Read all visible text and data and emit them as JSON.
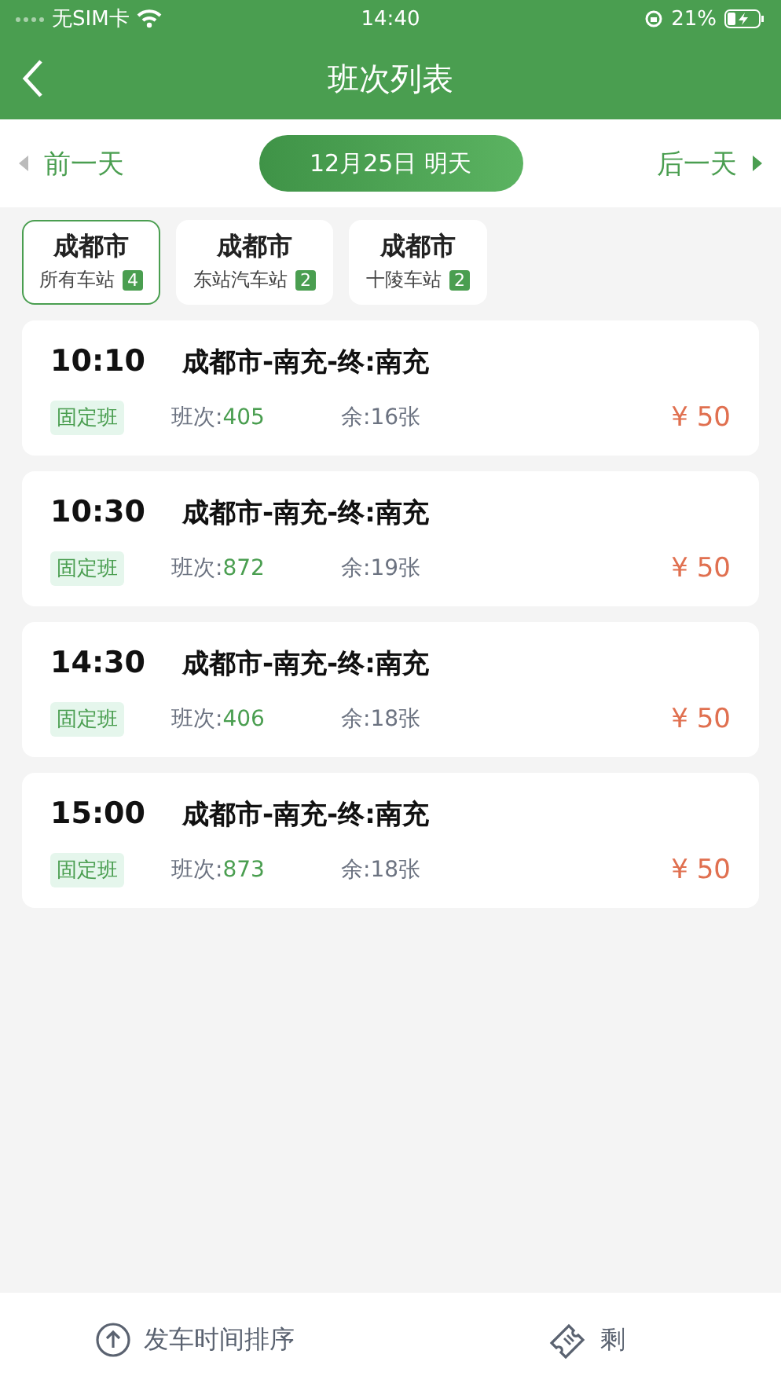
{
  "status_bar": {
    "carrier": "无SIM卡",
    "time": "14:40",
    "battery": "21%"
  },
  "header": {
    "title": "班次列表"
  },
  "date_bar": {
    "prev": "前一天",
    "date": "12月25日 明天",
    "next": "后一天"
  },
  "stations": [
    {
      "city": "成都市",
      "name": "所有车站",
      "count": "4",
      "selected": true
    },
    {
      "city": "成都市",
      "name": "东站汽车站",
      "count": "2",
      "selected": false
    },
    {
      "city": "成都市",
      "name": "十陵车站",
      "count": "2",
      "selected": false
    }
  ],
  "trips": [
    {
      "time": "10:10",
      "route": "成都市-南充-终:南充",
      "tag": "固定班",
      "trip_label": "班次:",
      "trip_no": "405",
      "seats": "余:16张",
      "price": "¥ 50"
    },
    {
      "time": "10:30",
      "route": "成都市-南充-终:南充",
      "tag": "固定班",
      "trip_label": "班次:",
      "trip_no": "872",
      "seats": "余:19张",
      "price": "¥ 50"
    },
    {
      "time": "14:30",
      "route": "成都市-南充-终:南充",
      "tag": "固定班",
      "trip_label": "班次:",
      "trip_no": "406",
      "seats": "余:18张",
      "price": "¥ 50"
    },
    {
      "time": "15:00",
      "route": "成都市-南充-终:南充",
      "tag": "固定班",
      "trip_label": "班次:",
      "trip_no": "873",
      "seats": "余:18张",
      "price": "¥ 50"
    }
  ],
  "footer": [
    {
      "kind": "sort",
      "label": "发车时间排序"
    },
    {
      "kind": "ticket",
      "label": "剩"
    }
  ]
}
